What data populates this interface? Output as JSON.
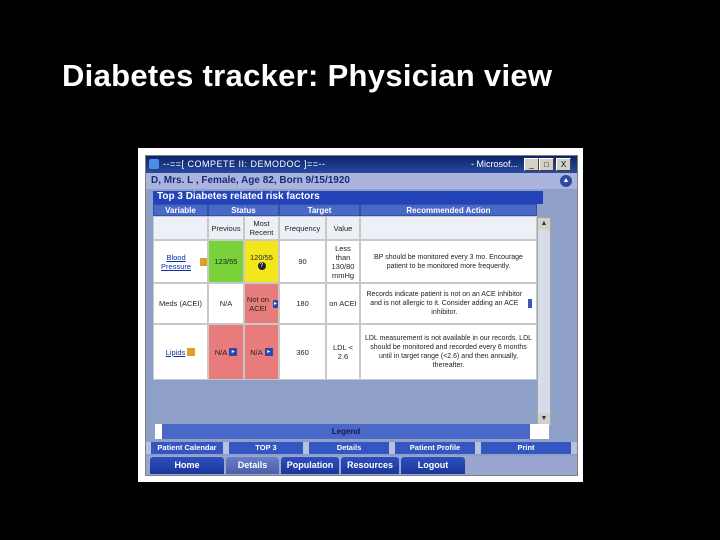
{
  "slide_title": "Diabetes tracker: Physician view",
  "window": {
    "title": "--==[ COMPETE II: DEMODOC ]==--",
    "app": "- Microsof...",
    "buttons": {
      "min": "_",
      "max": "□",
      "close": "X"
    }
  },
  "patient_header": "D, Mrs. L , Female, Age 82, Born 9/15/1920",
  "section_title": "Top 3 Diabetes related risk factors",
  "table": {
    "headers": {
      "variable": "Variable",
      "status": "Status",
      "target": "Target",
      "action": "Recommended Action"
    },
    "subheaders": {
      "previous": "Previous",
      "most_recent": "Most Recent",
      "frequency": "Frequency",
      "value": "Value"
    },
    "rows": [
      {
        "variable": "Blood Pressure",
        "previous": "123/55",
        "recent": "120/55",
        "frequency": "90",
        "value": "Less than 130/80 mmHg",
        "action": "BP should be monitored every 3 mo. Encourage patient to be monitored more frequently."
      },
      {
        "variable": "Meds (ACEI)",
        "previous": "N/A",
        "recent": "Not on ACEI",
        "frequency": "180",
        "value": "on ACEI",
        "action": "Records indicate patient is not on an ACE inhibitor and is not allergic to it. Consider adding an ACE inhibitor."
      },
      {
        "variable": "Lipids",
        "previous": "N/A",
        "recent": "N/A",
        "frequency": "360",
        "value": "LDL < 2.6",
        "action": "LDL measurement is not available in our records. LDL should be monitored and recorded every 6 months until in target range (<2.6) and then annually, thereafter."
      }
    ]
  },
  "legend": "Legend",
  "bottom_tabs": [
    "Patient Calendar",
    "TOP 3",
    "Details",
    "Patient Profile",
    "Print"
  ],
  "main_nav": [
    "Home",
    "Details",
    "Population",
    "Resources",
    "Logout"
  ],
  "colors": {
    "good": "#79d23a",
    "caution": "#f4e61c",
    "alert": "#e87c7c",
    "header_blue": "#4a68c8"
  }
}
